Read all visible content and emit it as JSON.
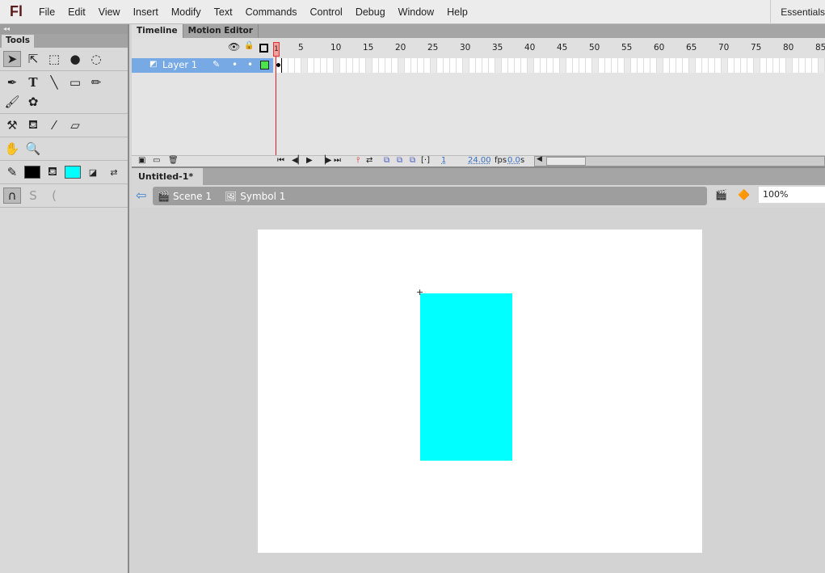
{
  "app": {
    "logo": "Fl",
    "workspace": "Essentials"
  },
  "menu": [
    "File",
    "Edit",
    "View",
    "Insert",
    "Modify",
    "Text",
    "Commands",
    "Control",
    "Debug",
    "Window",
    "Help"
  ],
  "tools": {
    "panel_title": "Tools",
    "collapse": "◂◂"
  },
  "timeline": {
    "tabs": [
      "Timeline",
      "Motion Editor"
    ],
    "frame_labels": [
      "1",
      "5",
      "10",
      "15",
      "20",
      "25",
      "30",
      "35",
      "40",
      "45",
      "50",
      "55",
      "60",
      "65",
      "70",
      "75",
      "80",
      "85"
    ],
    "layer": "Layer 1",
    "current_frame": "1",
    "fps": "24.00",
    "fps_unit": "fps",
    "time": "0.0",
    "time_unit": "s"
  },
  "document": {
    "tab": "Untitled-1*",
    "close": "×",
    "scenes": [
      "Scene 1",
      "Symbol 1"
    ],
    "zoom": "100%"
  },
  "colors": {
    "stroke": "#000000",
    "fill": "#00ffff",
    "shape": "#00ffff",
    "stage": "#ffffff"
  }
}
